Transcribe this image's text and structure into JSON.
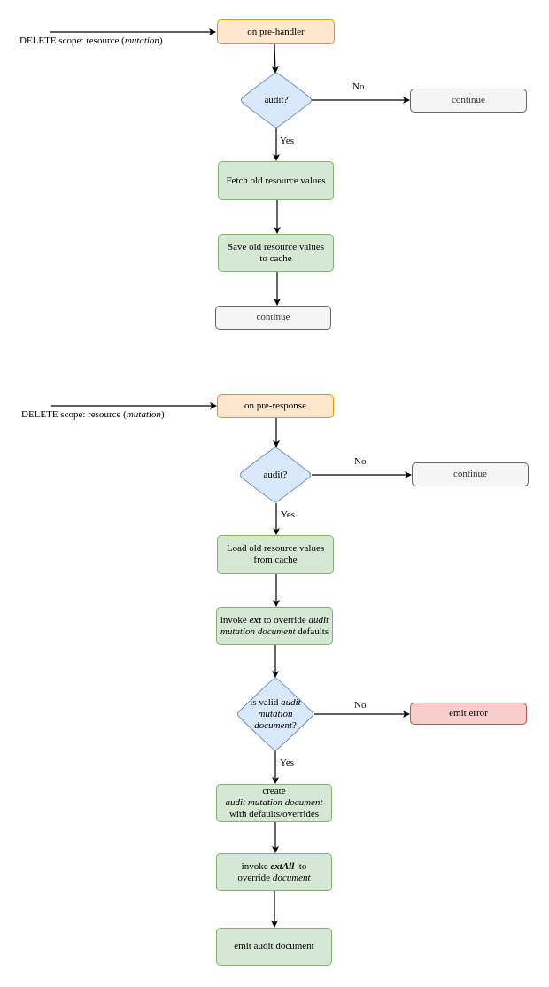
{
  "colors": {
    "start": "#ffe6cc",
    "start_border": "#d79b00",
    "decision": "#dae8fc",
    "decision_border": "#6c8ebf",
    "process": "#d5e8d4",
    "process_border": "#82b366",
    "terminal": "#f5f5f5",
    "terminal_border": "#666666",
    "error": "#f8cecc",
    "error_border": "#b85450"
  },
  "flow1": {
    "input_label": {
      "prefix": "DELETE scope: resource (",
      "italic": "mutation",
      "suffix": ")"
    },
    "start": "on pre-handler",
    "decision": "audit?",
    "no_label": "No",
    "yes_label": "Yes",
    "no_target": "continue",
    "step1": "Fetch old resource values",
    "step2": "Save old resource values to cache",
    "end": "continue"
  },
  "flow2": {
    "input_label": {
      "prefix": "DELETE scope: resource (",
      "italic": "mutation",
      "suffix": ")"
    },
    "start": "on pre-response",
    "decision": "audit?",
    "no_label": "No",
    "yes_label": "Yes",
    "no_target": "continue",
    "step1": "Load old resource values from cache",
    "step2": {
      "t1": "invoke ",
      "b1": "ext",
      "t2": " to override ",
      "i1": "audit mutation document",
      "t3": " defaults"
    },
    "decision2": {
      "t1": "is valid ",
      "i1": "audit mutation document",
      "t2": "?"
    },
    "no_label2": "No",
    "yes_label2": "Yes",
    "error": "emit error",
    "step3": {
      "t1": "create",
      "i1": "audit mutation document",
      "t2": "with defaults/overrides"
    },
    "step4": {
      "t1": "invoke ",
      "b1": "extAll",
      "t2": "  to override ",
      "i1": "document"
    },
    "end": "emit audit document"
  }
}
